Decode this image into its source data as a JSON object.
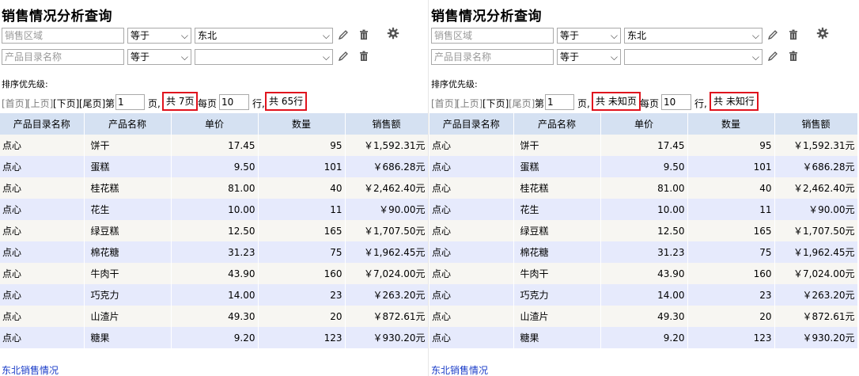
{
  "panels": [
    {
      "id": "left",
      "title": "销售情况分析查询",
      "filters": [
        {
          "field_placeholder": "销售区域",
          "operator": "等于",
          "value": "东北"
        },
        {
          "field_placeholder": "产品目录名称",
          "operator": "等于",
          "value": ""
        }
      ],
      "sort_label": "排序优先级:",
      "pager": {
        "first": "[首页]",
        "prev": "[上页]",
        "next": "[下页]",
        "last": "[尾页]",
        "page_prefix": "第",
        "page_value": "1",
        "page_suffix": "页,",
        "total_pages": "共 7页",
        "per_page_prefix": "每页",
        "per_page_value": "10",
        "rows_suffix": "行,",
        "total_rows": "共 65行"
      },
      "footer_link": "东北销售情况"
    },
    {
      "id": "right",
      "title": "销售情况分析查询",
      "filters": [
        {
          "field_placeholder": "销售区域",
          "operator": "等于",
          "value": "东北"
        },
        {
          "field_placeholder": "产品目录名称",
          "operator": "等于",
          "value": ""
        }
      ],
      "sort_label": "排序优先级:",
      "pager": {
        "first": "[首页]",
        "prev": "[上页]",
        "next": "[下页]",
        "last": "[尾页]",
        "page_prefix": "第",
        "page_value": "1",
        "page_suffix": "页,",
        "total_pages": "共 未知页",
        "per_page_prefix": "每页",
        "per_page_value": "10",
        "rows_suffix": "行,",
        "total_rows": "共 未知行"
      },
      "footer_link": "东北销售情况"
    }
  ],
  "table": {
    "headers": [
      "产品目录名称",
      "产品名称",
      "单价",
      "数量",
      "销售额"
    ],
    "rows": [
      [
        "点心",
        "饼干",
        "17.45",
        "95",
        "￥1,592.31元"
      ],
      [
        "点心",
        "蛋糕",
        "9.50",
        "101",
        "￥686.28元"
      ],
      [
        "点心",
        "桂花糕",
        "81.00",
        "40",
        "￥2,462.40元"
      ],
      [
        "点心",
        "花生",
        "10.00",
        "11",
        "￥90.00元"
      ],
      [
        "点心",
        "绿豆糕",
        "12.50",
        "165",
        "￥1,707.50元"
      ],
      [
        "点心",
        "棉花糖",
        "31.23",
        "75",
        "￥1,962.45元"
      ],
      [
        "点心",
        "牛肉干",
        "43.90",
        "160",
        "￥7,024.00元"
      ],
      [
        "点心",
        "巧克力",
        "14.00",
        "23",
        "￥263.20元"
      ],
      [
        "点心",
        "山渣片",
        "49.30",
        "20",
        "￥872.61元"
      ],
      [
        "点心",
        "糖果",
        "9.20",
        "123",
        "￥930.20元"
      ]
    ]
  },
  "colors": {
    "header_bg": "#d5e1f2",
    "row_odd": "#f7f6f2",
    "row_even": "#e6eafc",
    "highlight": "#e0141e",
    "link": "#1a3cc8"
  },
  "icons": [
    "edit-icon",
    "delete-icon",
    "gear-icon",
    "chevron-down-icon"
  ]
}
